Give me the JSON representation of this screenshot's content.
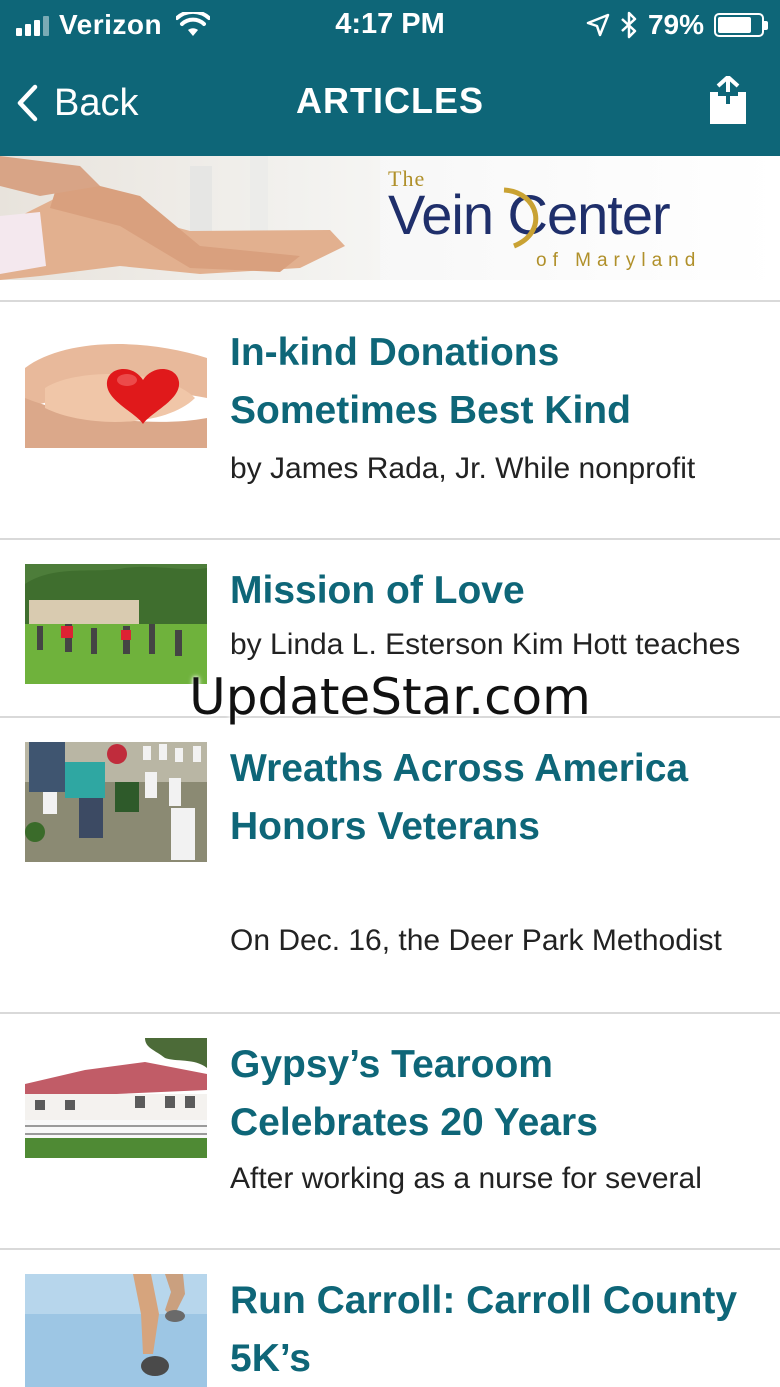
{
  "status_bar": {
    "carrier": "Verizon",
    "time": "4:17 PM",
    "battery_percent_label": "79%",
    "battery_level": 0.79,
    "icons": [
      "signal-icon",
      "wifi-icon",
      "location-icon",
      "bluetooth-icon",
      "battery-icon"
    ]
  },
  "nav": {
    "back_label": "Back",
    "title": "ARTICLES",
    "share_icon": "share-icon"
  },
  "banner": {
    "logo_the": "The",
    "logo_main": "Vein Center",
    "logo_sub": "of Maryland"
  },
  "articles": [
    {
      "title": "In-kind Donations Sometimes Best Kind",
      "excerpt": "by James Rada, Jr. While nonprofit"
    },
    {
      "title": "Mission of Love",
      "excerpt": "by Linda L. Esterson Kim Hott teaches"
    },
    {
      "title": "Wreaths Across America Honors Veterans",
      "excerpt": "On Dec. 16, the Deer Park Methodist"
    },
    {
      "title": "Gypsy’s Tearoom Celebrates 20 Years",
      "excerpt": "After working as a nurse for several"
    },
    {
      "title": "Run Carroll: Carroll County 5K’s",
      "excerpt": ""
    }
  ],
  "watermark": "UpdateStar.com",
  "colors": {
    "brand": "#0e6678",
    "title_text": "#0e6678",
    "logo_navy": "#1f2f6b",
    "logo_gold": "#b0902a"
  }
}
